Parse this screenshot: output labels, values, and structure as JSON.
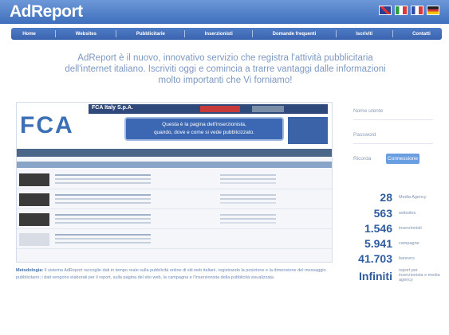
{
  "header": {
    "logo": "AdReport",
    "flags": [
      "uk-flag",
      "it-flag",
      "fr-flag",
      "de-flag"
    ]
  },
  "nav": {
    "items": [
      "Home",
      "Websites",
      "Pubblicitarie",
      "Inserzionisti",
      "Domande frequenti",
      "Iscriviti",
      "Contatti"
    ]
  },
  "intro": {
    "line1": "AdReport è il nuovo, innovativo servizio che registra l'attività pubblicitaria",
    "line2": "dell'internet italiano. Iscriviti oggi e comincia a trarre vantaggi dalle informazioni",
    "line3": "molto importanti che Vi forniamo!"
  },
  "preview": {
    "logo": "FCA",
    "topbar_title": "FCA Italy S.p.A.",
    "tooltip_line1": "Questa è la pagina dell'inserzionista,",
    "tooltip_line2": "quando, dove e come si vede pubblicizzato."
  },
  "login": {
    "username_label": "Nome utente",
    "password_label": "Password",
    "remember_label": "Ricorda",
    "login_button": "Connessione"
  },
  "stats": [
    {
      "value": "28",
      "label": "Media Agency"
    },
    {
      "value": "563",
      "label": "websites"
    },
    {
      "value": "1.546",
      "label": "inserzionisti"
    },
    {
      "value": "5.941",
      "label": "campagne"
    },
    {
      "value": "41.703",
      "label": "banners"
    },
    {
      "value": "Infiniti",
      "label": "report per inserzionista e media agency"
    }
  ],
  "footnote": {
    "title": "Metodologia:",
    "text": "Il sistema AdReport raccoglie dati in tempo reale sulla pubblicità online di siti web italiani, registrando la posizione e la dimensione del messaggio pubblicitario; i dati vengono elaborati per il report, sulla pagina del sito web, la campagna e l'inserzionista della pubblicità visualizzata."
  },
  "colors": {
    "header_bg": "#4f7cc6",
    "nav_bg": "#3a63ae",
    "accent_text": "#2f5b9e",
    "button_bg": "#6a9ee2"
  }
}
